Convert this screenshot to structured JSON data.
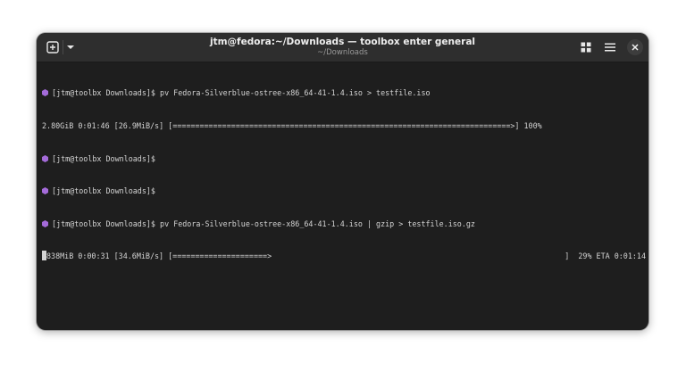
{
  "window": {
    "title": "jtm@fedora:~/Downloads — toolbox enter general",
    "subtitle": "~/Downloads"
  },
  "header": {
    "new_tab_icon": "plus-square-icon",
    "dropdown_icon": "chevron-down-icon",
    "grid_icon": "grid-icon",
    "menu_icon": "hamburger-menu-icon",
    "close_icon": "close-icon"
  },
  "terminal": {
    "prompt_icon_color": "#a46bd9",
    "lines": [
      {
        "prompt": "[jtm@toolbx Downloads]$",
        "command": " pv Fedora-Silverblue-ostree-x86_64-41-1.4.iso > testfile.iso"
      },
      {
        "output": "2.80GiB 0:01:46 [26.9MiB/s] [===========================================================================>] 100%"
      },
      {
        "prompt": "[jtm@toolbx Downloads]$",
        "command": ""
      },
      {
        "prompt": "[jtm@toolbx Downloads]$",
        "command": ""
      },
      {
        "prompt": "[jtm@toolbx Downloads]$",
        "command": " pv Fedora-Silverblue-ostree-x86_64-41-1.4.iso | gzip > testfile.iso.gz"
      },
      {
        "progress_left": "838MiB 0:00:31 [34.6MiB/s] [=====================>",
        "progress_right": "]  29% ETA 0:01:14"
      }
    ]
  }
}
